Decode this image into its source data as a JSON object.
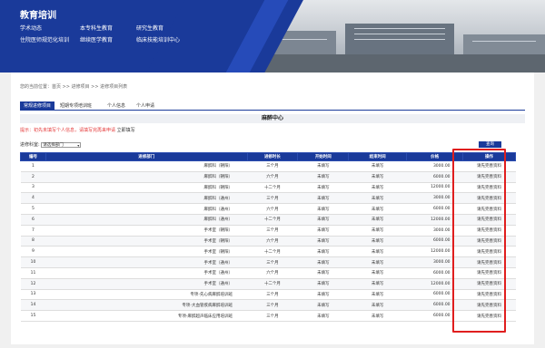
{
  "header": {
    "title": "教育培训",
    "nav": [
      "学术动态",
      "本专科生教育",
      "研究生教育",
      "住院医师规范化培训",
      "继续医学教育",
      "临床技能培训中心"
    ]
  },
  "breadcrumb": "您的当前位置：首页 >> 进修项目 >> 进修项目列表",
  "tabs": [
    "常规进修项目",
    "短期专项培训班",
    "个人信息",
    "个人申请"
  ],
  "center_title": "麻醉中心",
  "notice": {
    "text": "提示：初先未填写个人信息，请填写完再来申请",
    "link": "立即填写"
  },
  "filter": {
    "label": "进修科室:",
    "value": "请选择部门"
  },
  "query_button": "查询",
  "table": {
    "headers": [
      "编号",
      "进修部门",
      "进修时长",
      "开始时间",
      "结束时间",
      "价格",
      "操作"
    ],
    "rows": [
      [
        "1",
        "麻醉科（朝阳）",
        "三个月",
        "未填写",
        "未填写",
        "3000.00",
        "请先完善资料"
      ],
      [
        "2",
        "麻醉科（朝阳）",
        "六个月",
        "未填写",
        "未填写",
        "6000.00",
        "请先完善资料"
      ],
      [
        "3",
        "麻醉科（朝阳）",
        "十二个月",
        "未填写",
        "未填写",
        "12000.00",
        "请先完善资料"
      ],
      [
        "4",
        "麻醉科（通州）",
        "三个月",
        "未填写",
        "未填写",
        "3000.00",
        "请先完善资料"
      ],
      [
        "5",
        "麻醉科（通州）",
        "六个月",
        "未填写",
        "未填写",
        "6000.00",
        "请先完善资料"
      ],
      [
        "6",
        "麻醉科（通州）",
        "十二个月",
        "未填写",
        "未填写",
        "12000.00",
        "请先完善资料"
      ],
      [
        "7",
        "手术室（朝阳）",
        "三个月",
        "未填写",
        "未填写",
        "3000.00",
        "请先完善资料"
      ],
      [
        "8",
        "手术室（朝阳）",
        "六个月",
        "未填写",
        "未填写",
        "6000.00",
        "请先完善资料"
      ],
      [
        "9",
        "手术室（朝阳）",
        "十二个月",
        "未填写",
        "未填写",
        "12000.00",
        "请先完善资料"
      ],
      [
        "10",
        "手术室（通州）",
        "三个月",
        "未填写",
        "未填写",
        "3000.00",
        "请先完善资料"
      ],
      [
        "11",
        "手术室（通州）",
        "六个月",
        "未填写",
        "未填写",
        "6000.00",
        "请先完善资料"
      ],
      [
        "12",
        "手术室（通州）",
        "十二个月",
        "未填写",
        "未填写",
        "12000.00",
        "请先完善资料"
      ],
      [
        "13",
        "专项-先心病麻醉培训班",
        "三个月",
        "未填写",
        "未填写",
        "6000.00",
        "请先完善资料"
      ],
      [
        "14",
        "专项-大血管疾病麻醉培训班",
        "三个月",
        "未填写",
        "未填写",
        "6000.00",
        "请先完善资料"
      ],
      [
        "15",
        "专项-麻醉超声临床应用培训班",
        "三个月",
        "未填写",
        "未填写",
        "6000.00",
        "请先完善资料"
      ]
    ]
  },
  "colors": {
    "primary": "#1a3a9a",
    "highlight": "#e01e1e",
    "notice": "#e53a3a"
  }
}
